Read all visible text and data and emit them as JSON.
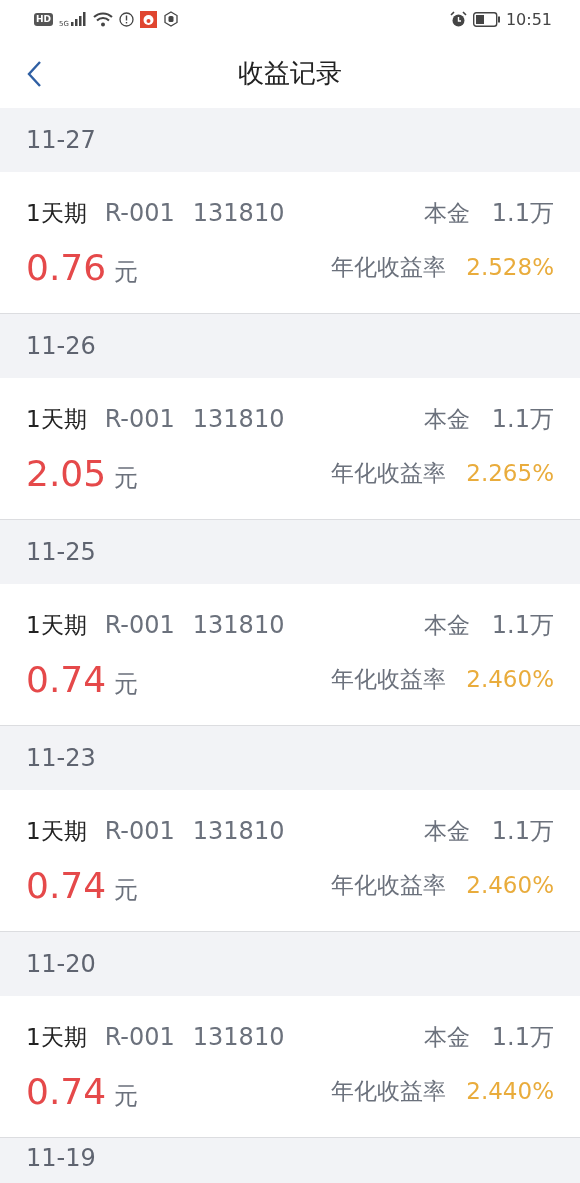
{
  "status_bar": {
    "hd": "HD",
    "network": "5G",
    "time": "10:51"
  },
  "header": {
    "title": "收益记录"
  },
  "records": [
    {
      "date": "11-27",
      "term": "1天期",
      "code": "R-001",
      "number": "131810",
      "principal_label": "本金",
      "principal": "1.1万",
      "amount": "0.76",
      "unit": "元",
      "rate_label": "年化收益率",
      "rate": "2.528%"
    },
    {
      "date": "11-26",
      "term": "1天期",
      "code": "R-001",
      "number": "131810",
      "principal_label": "本金",
      "principal": "1.1万",
      "amount": "2.05",
      "unit": "元",
      "rate_label": "年化收益率",
      "rate": "2.265%"
    },
    {
      "date": "11-25",
      "term": "1天期",
      "code": "R-001",
      "number": "131810",
      "principal_label": "本金",
      "principal": "1.1万",
      "amount": "0.74",
      "unit": "元",
      "rate_label": "年化收益率",
      "rate": "2.460%"
    },
    {
      "date": "11-23",
      "term": "1天期",
      "code": "R-001",
      "number": "131810",
      "principal_label": "本金",
      "principal": "1.1万",
      "amount": "0.74",
      "unit": "元",
      "rate_label": "年化收益率",
      "rate": "2.460%"
    },
    {
      "date": "11-20",
      "term": "1天期",
      "code": "R-001",
      "number": "131810",
      "principal_label": "本金",
      "principal": "1.1万",
      "amount": "0.74",
      "unit": "元",
      "rate_label": "年化收益率",
      "rate": "2.440%"
    }
  ],
  "next_date": "11-19"
}
